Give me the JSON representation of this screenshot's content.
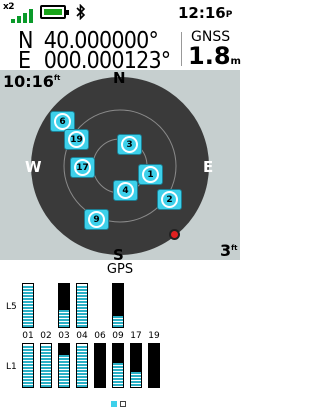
{
  "status": {
    "signal_multiplier": "x2",
    "signal_bars": 4,
    "battery_level": 0.8,
    "bluetooth_icon": "bluetooth-icon",
    "time": "12:16",
    "time_suffix": "P"
  },
  "position": {
    "lat_hemisphere": "N",
    "lat_value": "40.000000°",
    "lon_hemisphere": "E",
    "lon_value": "000.000123°"
  },
  "gnss": {
    "label": "GNSS",
    "accuracy": "1.8",
    "unit": "m"
  },
  "skyplot": {
    "elevation_label": "10:16",
    "elevation_suffix": "ft",
    "compass": {
      "north": "N",
      "south": "S",
      "east": "E",
      "west": "W"
    },
    "scale_value": "3",
    "scale_unit": "ft",
    "satellites": [
      {
        "id": "6"
      },
      {
        "id": "19"
      },
      {
        "id": "3"
      },
      {
        "id": "17"
      },
      {
        "id": "1"
      },
      {
        "id": "4"
      },
      {
        "id": "2"
      },
      {
        "id": "9"
      }
    ]
  },
  "signal_panel": {
    "title": "GPS",
    "band_top": "L5",
    "band_bottom": "L1",
    "prns": [
      "01",
      "02",
      "03",
      "04",
      "06",
      "09",
      "17",
      "19"
    ],
    "l5_levels": [
      0.95,
      null,
      0.4,
      0.95,
      null,
      0.25,
      null,
      null
    ],
    "l1_levels": [
      0.95,
      0.95,
      0.75,
      0.95,
      0.0,
      0.55,
      0.35,
      0.0
    ],
    "page_indicator": {
      "pages": 2,
      "active": 1
    }
  },
  "colors": {
    "sky_background": "#c6cfcf",
    "sky_disc": "#3a3a3a",
    "satellite": "#3dd0ea",
    "bar_fill": "#2ab0c6",
    "bar_dark": "#000000"
  }
}
